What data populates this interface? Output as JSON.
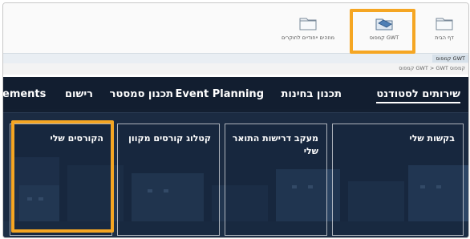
{
  "toolbar": {
    "home_label": "דף הבית",
    "gwt_label": "קמפוס GWT",
    "search_label": "מוזהים ייחודיים לחוקרים"
  },
  "breadcrumb_bar": {
    "tag": "קמפוס GWT",
    "path": "קמפוס GWT > GWT קמפוס"
  },
  "nav": {
    "items": [
      "שירותים לסטודנט",
      "תכנון בחינות",
      "Event Planning",
      "תכנון סמסטר",
      "רישום",
      "ements"
    ]
  },
  "tiles": [
    {
      "label": "בקשות שלי"
    },
    {
      "label": "מעקב דרישות התואר שלי"
    },
    {
      "label": "קטלוג קורסים מקוון"
    },
    {
      "label": "הקורסים שלי"
    }
  ],
  "colors": {
    "highlight": "#f5a623",
    "hero_bg": "#162438"
  }
}
